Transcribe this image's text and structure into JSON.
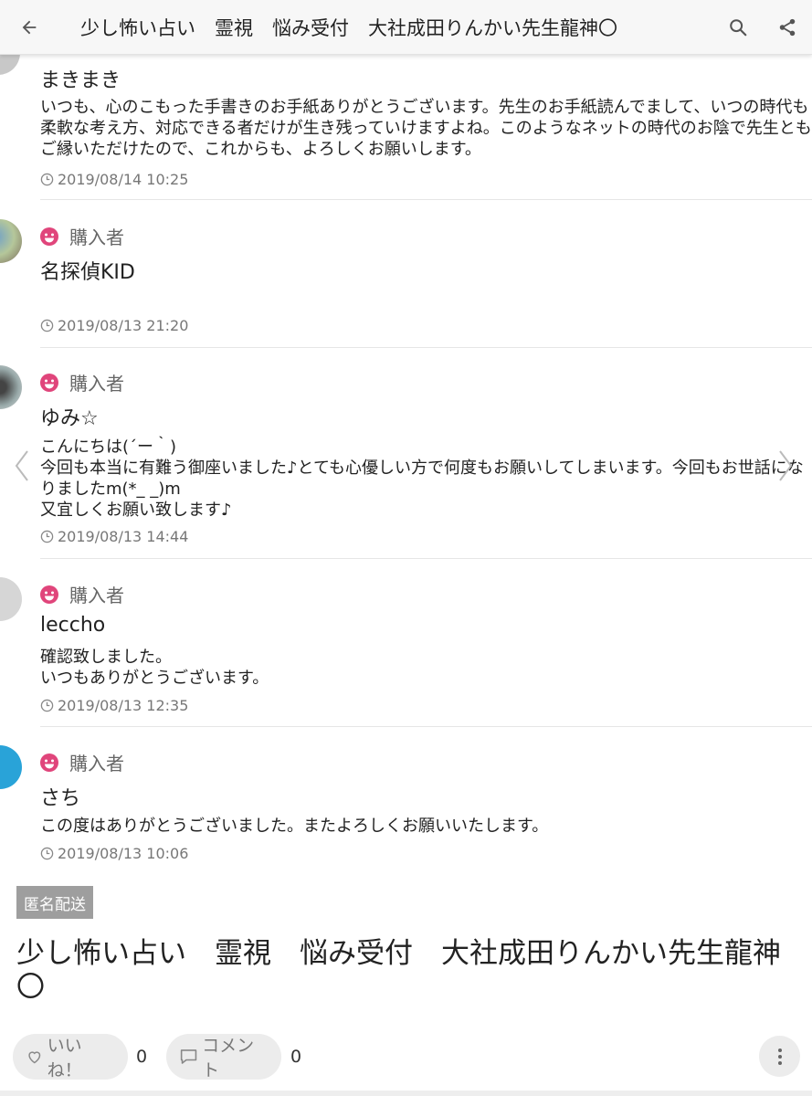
{
  "appbar": {
    "title": "少し怖い占い　霊視　悩み受付　大社成田りんかい先生龍神〇"
  },
  "comments": [
    {
      "name": "まきまき",
      "body": "いつも、心のこもった手書きのお手紙ありがとうございます。先生のお手紙読んでまして、いつの時代も柔軟な考え方、対応できる者だけが生き残っていけますよね。このようなネットの時代のお陰で先生ともご縁いただけたので、これからも、よろしくお願いします。",
      "timestamp": "2019/08/14 10:25"
    },
    {
      "role": "購入者",
      "name": "名探偵KID",
      "body": "",
      "timestamp": "2019/08/13 21:20"
    },
    {
      "role": "購入者",
      "name": "ゆみ☆",
      "body": "こんにちは(´ー｀)\n今回も本当に有難う御座いました♪とても心優しい方で何度もお願いしてしまいます。今回もお世話になりましたm(*_ _)m\n又宜しくお願い致します♪",
      "timestamp": "2019/08/13 14:44"
    },
    {
      "role": "購入者",
      "name": "leccho",
      "body": "確認致しました。\nいつもありがとうございます。",
      "timestamp": "2019/08/13 12:35"
    },
    {
      "role": "購入者",
      "name": "さち",
      "body": "この度はありがとうございました。またよろしくお願いいたします。",
      "timestamp": "2019/08/13 10:06"
    }
  ],
  "badge": "匿名配送",
  "item_title": "少し怖い占い　霊視　悩み受付　大社成田りんかい先生龍神〇",
  "actions": {
    "like_label": "いいね！",
    "like_count": "0",
    "comment_label": "コメント",
    "comment_count": "0"
  },
  "icons": {
    "back": "arrow-left-icon",
    "search": "search-icon",
    "share": "share-icon",
    "buyer": "smiley-face-icon",
    "clock": "clock-icon",
    "heart": "heart-icon",
    "speech": "speech-bubble-icon",
    "more": "more-vertical-icon"
  },
  "colors": {
    "buyer_icon": "#e0457b",
    "badge_bg": "#9e9e9e",
    "pill_bg": "#ececec"
  }
}
